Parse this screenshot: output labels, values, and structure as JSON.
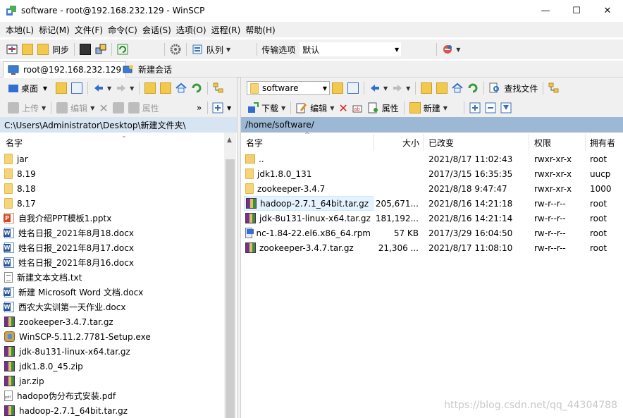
{
  "window": {
    "title": "software - root@192.168.232.129 - WinSCP",
    "minimize": "—",
    "maximize": "☐",
    "close": "✕"
  },
  "menu": [
    "本地(L)",
    "标记(M)",
    "文件(F)",
    "命令(C)",
    "会话(S)",
    "选项(O)",
    "远程(R)",
    "帮助(H)"
  ],
  "toolbar_main": {
    "sync_label": "同步",
    "queue_label": "队列",
    "transfer_options_label": "传输选项",
    "transfer_preset": "默认"
  },
  "session_tabs": {
    "active": "root@192.168.232.129",
    "new": "新建会话"
  },
  "left_nav": {
    "location": "桌面"
  },
  "left_actions": {
    "upload": "上传",
    "edit": "编辑",
    "properties": "属性"
  },
  "right_nav": {
    "location": "software",
    "find_files": "查找文件"
  },
  "right_actions": {
    "download": "下载",
    "edit": "编辑",
    "properties": "属性",
    "new": "新建"
  },
  "left_path": "C:\\Users\\Administrator\\Desktop\\新建文件夹\\",
  "right_path": "/home/software/",
  "left_panel": {
    "column_name": "名字",
    "files": [
      {
        "name": "jar",
        "icon": "folder-icon"
      },
      {
        "name": "8.19",
        "icon": "folder-icon"
      },
      {
        "name": "8.18",
        "icon": "folder-icon"
      },
      {
        "name": "8.17",
        "icon": "folder-icon"
      },
      {
        "name": "自我介绍PPT模板1.pptx",
        "icon": "ppt-icon"
      },
      {
        "name": "姓名日报_2021年8月18.docx",
        "icon": "word-icon"
      },
      {
        "name": "姓名日报_2021年8月17.docx",
        "icon": "word-icon"
      },
      {
        "name": "姓名日报_2021年8月16.docx",
        "icon": "word-icon"
      },
      {
        "name": "新建文本文档.txt",
        "icon": "txt-icon"
      },
      {
        "name": "新建 Microsoft Word 文档.docx",
        "icon": "word-icon"
      },
      {
        "name": "西农大实训第一天作业.docx",
        "icon": "word-icon"
      },
      {
        "name": "zookeeper-3.4.7.tar.gz",
        "icon": "archive-icon"
      },
      {
        "name": "WinSCP-5.11.2.7781-Setup.exe",
        "icon": "setup-icon"
      },
      {
        "name": "jdk-8u131-linux-x64.tar.gz",
        "icon": "archive-icon"
      },
      {
        "name": "jdk1.8.0_45.zip",
        "icon": "archive-icon"
      },
      {
        "name": "jar.zip",
        "icon": "archive-icon"
      },
      {
        "name": "hadopo伪分布式安装.pdf",
        "icon": "pdf-icon"
      },
      {
        "name": "hadoop-2.7.1_64bit.tar.gz",
        "icon": "archive-icon"
      }
    ]
  },
  "right_panel": {
    "columns": {
      "name": "名字",
      "size": "大小",
      "modified": "已改变",
      "rights": "权限",
      "owner": "拥有者"
    },
    "files": [
      {
        "name": "..",
        "size": "",
        "modified": "2021/8/17 11:02:43",
        "rights": "rwxr-xr-x",
        "owner": "root",
        "icon": "parent-dir-icon"
      },
      {
        "name": "jdk1.8.0_131",
        "size": "",
        "modified": "2017/3/15 16:35:35",
        "rights": "rwxr-xr-x",
        "owner": "uucp",
        "icon": "folder-icon"
      },
      {
        "name": "zookeeper-3.4.7",
        "size": "",
        "modified": "2021/8/18 9:47:47",
        "rights": "rwxr-xr-x",
        "owner": "1000",
        "icon": "folder-icon"
      },
      {
        "name": "hadoop-2.7.1_64bit.tar.gz",
        "size": "205,671...",
        "modified": "2021/8/16 14:21:18",
        "rights": "rw-r--r--",
        "owner": "root",
        "icon": "archive-icon",
        "selected": true
      },
      {
        "name": "jdk-8u131-linux-x64.tar.gz",
        "size": "181,192...",
        "modified": "2021/8/16 14:21:14",
        "rights": "rw-r--r--",
        "owner": "root",
        "icon": "archive-icon"
      },
      {
        "name": "nc-1.84-22.el6.x86_64.rpm",
        "size": "57 KB",
        "modified": "2017/3/29 16:04:50",
        "rights": "rw-r--r--",
        "owner": "root",
        "icon": "rpm-icon"
      },
      {
        "name": "zookeeper-3.4.7.tar.gz",
        "size": "21,306 ...",
        "modified": "2021/8/17 11:08:10",
        "rights": "rw-r--r--",
        "owner": "root",
        "icon": "archive-icon"
      }
    ]
  },
  "watermark": "https://blog.csdn.net/qq_44304788"
}
